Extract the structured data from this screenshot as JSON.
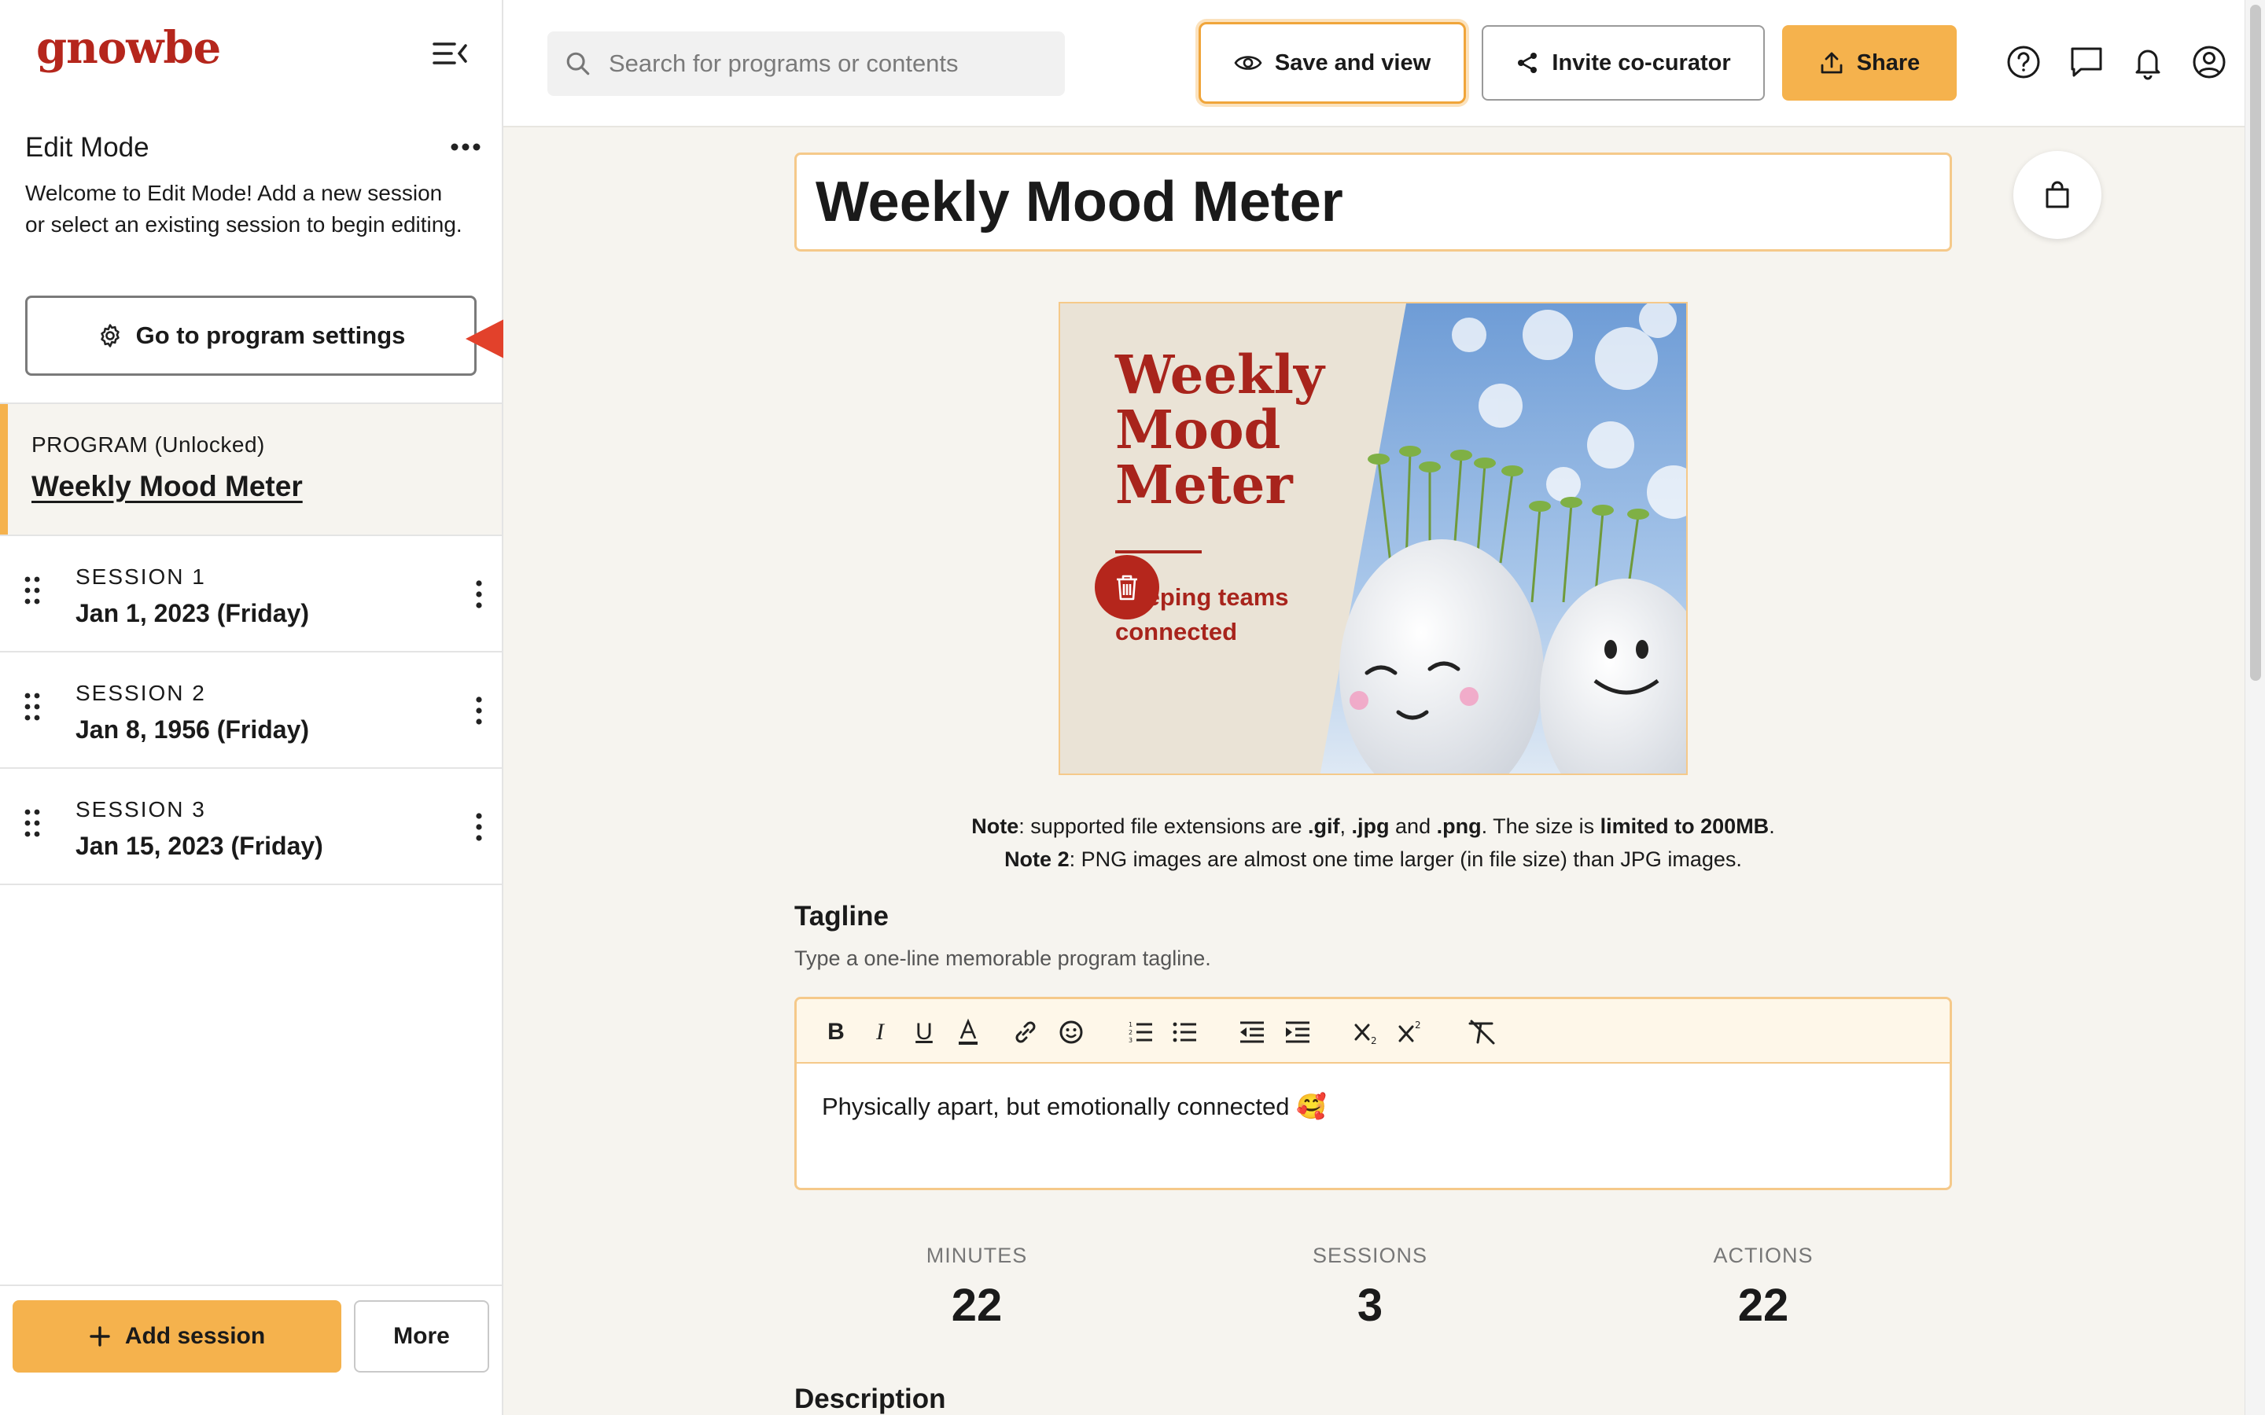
{
  "sidebar": {
    "logo": "gnowbe",
    "edit_title": "Edit Mode",
    "edit_description": "Welcome to Edit Mode! Add a new session or select an existing session to begin editing.",
    "settings_button": "Go to program settings",
    "program": {
      "label": "PROGRAM (Unlocked)",
      "name": "Weekly Mood Meter"
    },
    "sessions": [
      {
        "label": "SESSION 1",
        "date": "Jan 1, 2023 (Friday)"
      },
      {
        "label": "SESSION 2",
        "date": "Jan 8, 1956 (Friday)"
      },
      {
        "label": "SESSION 3",
        "date": "Jan 15, 2023 (Friday)"
      }
    ],
    "add_session": "Add session",
    "more": "More"
  },
  "topbar": {
    "search_placeholder": "Search for programs or contents",
    "save_and_view": "Save and view",
    "invite": "Invite co-curator",
    "share": "Share",
    "icons": [
      "help-icon",
      "chat-icon",
      "bell-icon",
      "account-icon"
    ]
  },
  "main": {
    "title": "Weekly Mood Meter",
    "cover": {
      "line1": "Weekly",
      "line2": "Mood",
      "line3": "Meter",
      "tagline1": "Keeping teams",
      "tagline2": "connected"
    },
    "note": {
      "n1_label": "Note",
      "n1_a": ": supported file extensions are ",
      "n1_gif": ".gif",
      "n1_sep": ", ",
      "n1_jpg": ".jpg",
      "n1_and": " and ",
      "n1_png": ".png",
      "n1_b": ". The size is ",
      "n1_limit": "limited to 200MB",
      "n1_end": ".",
      "n2_label": "Note 2",
      "n2_text": ": PNG images are almost one time larger (in file size) than JPG images."
    },
    "tagline_heading": "Tagline",
    "tagline_hint": "Type a one-line memorable program tagline.",
    "tagline_value": "Physically apart, but emotionally connected 🥰",
    "stats": [
      {
        "label": "MINUTES",
        "value": "22"
      },
      {
        "label": "SESSIONS",
        "value": "3"
      },
      {
        "label": "ACTIONS",
        "value": "22"
      }
    ],
    "description_heading": "Description"
  },
  "colors": {
    "accent": "#f5b24d",
    "brand": "#b5261c",
    "annotation_arrow": "#e2412b"
  }
}
